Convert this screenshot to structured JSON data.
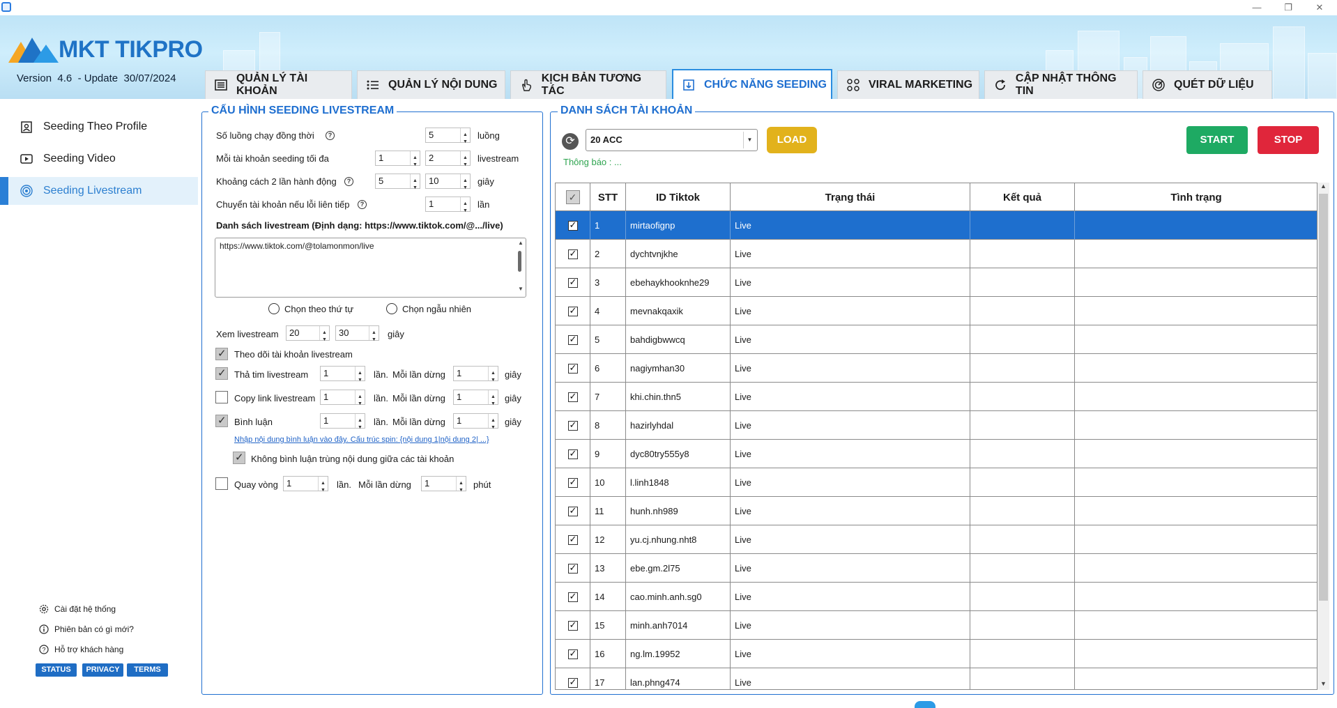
{
  "header": {
    "logo_text": "MKT TIKPRO",
    "version_label": "Version",
    "version": "4.6",
    "update_label": "- Update",
    "update_date": "30/07/2024"
  },
  "tabs": [
    {
      "label": "QUẢN LÝ TÀI KHOẢN",
      "icon": "account-list-icon"
    },
    {
      "label": "QUẢN LÝ NỘI DUNG",
      "icon": "content-list-icon"
    },
    {
      "label": "KỊCH BẢN TƯƠNG TÁC",
      "icon": "touch-hand-icon"
    },
    {
      "label": "CHỨC NĂNG SEEDING",
      "icon": "seeding-icon",
      "active": true
    },
    {
      "label": "VIRAL MARKETING",
      "icon": "viral-icon"
    },
    {
      "label": "CẬP NHẬT THÔNG TIN",
      "icon": "update-icon"
    },
    {
      "label": "QUÉT DỮ LIỆU",
      "icon": "radar-icon"
    }
  ],
  "sidebar": {
    "items": [
      {
        "label": "Seeding Theo Profile",
        "icon": "profile-icon"
      },
      {
        "label": "Seeding Video",
        "icon": "video-icon"
      },
      {
        "label": "Seeding Livestream",
        "icon": "livestream-icon",
        "active": true
      }
    ],
    "footer_links": [
      {
        "label": "Cài đặt hệ thống",
        "icon": "gear-icon"
      },
      {
        "label": "Phiên bản có gì mới?",
        "icon": "info-icon"
      },
      {
        "label": "Hỗ trợ khách hàng",
        "icon": "help-icon"
      }
    ],
    "pills": [
      "STATUS",
      "PRIVACY",
      "TERMS"
    ]
  },
  "config": {
    "title": "CẤU HÌNH SEEDING LIVESTREAM",
    "threads_label": "Số luồng chạy đồng thời",
    "threads_value": "5",
    "threads_unit": "luồng",
    "max_per_account_label": "Mỗi tài khoản seeding tối đa",
    "max_per_account_min": "1",
    "max_per_account_max": "2",
    "max_per_account_unit": "livestream",
    "interval_label": "Khoảng cách 2 lần hành động",
    "interval_min": "5",
    "interval_max": "10",
    "interval_unit": "giây",
    "switch_label": "Chuyển tài khoản nếu lỗi liên tiếp",
    "switch_value": "1",
    "switch_unit": "lần",
    "list_label": "Danh sách livestream (Định dạng: https://www.tiktok.com/@.../live)",
    "list_value": "https://www.tiktok.com/@tolamonmon/live",
    "order_sequential": "Chọn theo thứ tự",
    "order_random": "Chọn ngẫu nhiên",
    "watch_label": "Xem livestream",
    "watch_min": "20",
    "watch_max": "30",
    "watch_unit": "giây",
    "follow_label": "Theo dõi tài khoản livestream",
    "heart_label": "Thả tim livestream",
    "heart_times": "1",
    "heart_delay": "1",
    "copy_label": "Copy link livestream",
    "copy_times": "1",
    "copy_delay": "1",
    "comment_label": "Bình luận",
    "comment_times": "1",
    "comment_delay": "1",
    "times_unit": "lần.",
    "delay_label": "Mỗi lần dừng",
    "sec_unit": "giây",
    "comment_link": "Nhập nội dung bình luận vào đây. Cấu trúc spin: {nội dung 1|nội dung 2| ...}",
    "no_dup_label": "Không bình luận trùng nội dung giữa các tài khoản",
    "loop_label": "Quay vòng",
    "loop_value": "1",
    "loop_unit": "lần.",
    "loop_delay_label": "Mỗi lần dừng",
    "loop_delay_value": "1",
    "loop_delay_unit": "phút"
  },
  "accounts": {
    "title": "DANH SÁCH TÀI KHOẢN",
    "combo_value": "20 ACC",
    "load_label": "LOAD",
    "start_label": "START",
    "stop_label": "STOP",
    "notice": "Thông báo : ...",
    "columns": [
      "STT",
      "ID Tiktok",
      "Trạng thái",
      "Kết quả",
      "Tình trạng"
    ],
    "rows": [
      {
        "stt": "1",
        "id": "mirtaofignp",
        "status": "Live"
      },
      {
        "stt": "2",
        "id": "dychtvnjkhe",
        "status": "Live"
      },
      {
        "stt": "3",
        "id": "ebehaykhooknhe29",
        "status": "Live"
      },
      {
        "stt": "4",
        "id": "mevnakqaxik",
        "status": "Live"
      },
      {
        "stt": "5",
        "id": "bahdigbwwcq",
        "status": "Live"
      },
      {
        "stt": "6",
        "id": "nagiymhan30",
        "status": "Live"
      },
      {
        "stt": "7",
        "id": "khi.chin.thn5",
        "status": "Live"
      },
      {
        "stt": "8",
        "id": "hazirlyhdal",
        "status": "Live"
      },
      {
        "stt": "9",
        "id": "dyc80try555y8",
        "status": "Live"
      },
      {
        "stt": "10",
        "id": "l.linh1848",
        "status": "Live"
      },
      {
        "stt": "11",
        "id": "hunh.nh989",
        "status": "Live"
      },
      {
        "stt": "12",
        "id": "yu.cj.nhung.nht8",
        "status": "Live"
      },
      {
        "stt": "13",
        "id": "ebe.gm.2l75",
        "status": "Live"
      },
      {
        "stt": "14",
        "id": "cao.minh.anh.sg0",
        "status": "Live"
      },
      {
        "stt": "15",
        "id": "minh.anh7014",
        "status": "Live"
      },
      {
        "stt": "16",
        "id": "ng.lm.19952",
        "status": "Live"
      },
      {
        "stt": "17",
        "id": "lan.phng474",
        "status": "Live"
      }
    ]
  },
  "colors": {
    "accent": "#1f6fd0",
    "load": "#e2b21c",
    "start": "#1eaa63",
    "stop": "#e0263b",
    "selected_row": "#1e6fce",
    "notice": "#2ea44f"
  }
}
